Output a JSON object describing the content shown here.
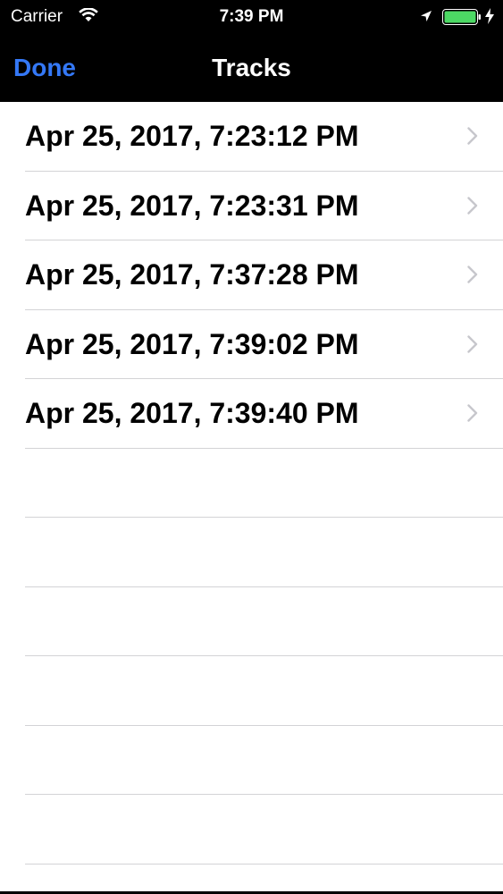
{
  "status_bar": {
    "carrier": "Carrier",
    "time": "7:39 PM",
    "icons": [
      "wifi-icon",
      "location-icon",
      "battery-icon",
      "charging-bolt-icon"
    ]
  },
  "nav_bar": {
    "done_label": "Done",
    "title": "Tracks"
  },
  "tracks": [
    "Apr 25, 2017, 7:23:12 PM",
    "Apr 25, 2017, 7:23:31 PM",
    "Apr 25, 2017, 7:37:28 PM",
    "Apr 25, 2017, 7:39:02 PM",
    "Apr 25, 2017, 7:39:40 PM"
  ],
  "colors": {
    "accent": "#3478f6",
    "battery": "#4cd964",
    "separator": "#d3d3d6",
    "chevron": "#c7c7cc"
  }
}
